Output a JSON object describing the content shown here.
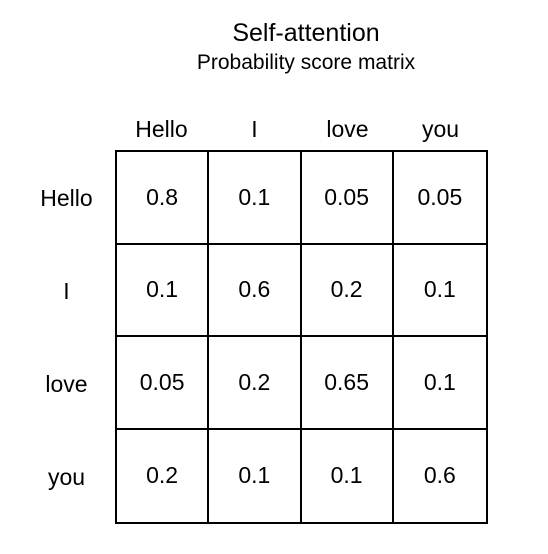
{
  "title": "Self-attention",
  "subtitle": "Probability score matrix",
  "columns": [
    "Hello",
    "I",
    "love",
    "you"
  ],
  "rows": [
    "Hello",
    "I",
    "love",
    "you"
  ],
  "matrix": [
    [
      "0.8",
      "0.1",
      "0.05",
      "0.05"
    ],
    [
      "0.1",
      "0.6",
      "0.2",
      "0.1"
    ],
    [
      "0.05",
      "0.2",
      "0.65",
      "0.1"
    ],
    [
      "0.2",
      "0.1",
      "0.1",
      "0.6"
    ]
  ]
}
